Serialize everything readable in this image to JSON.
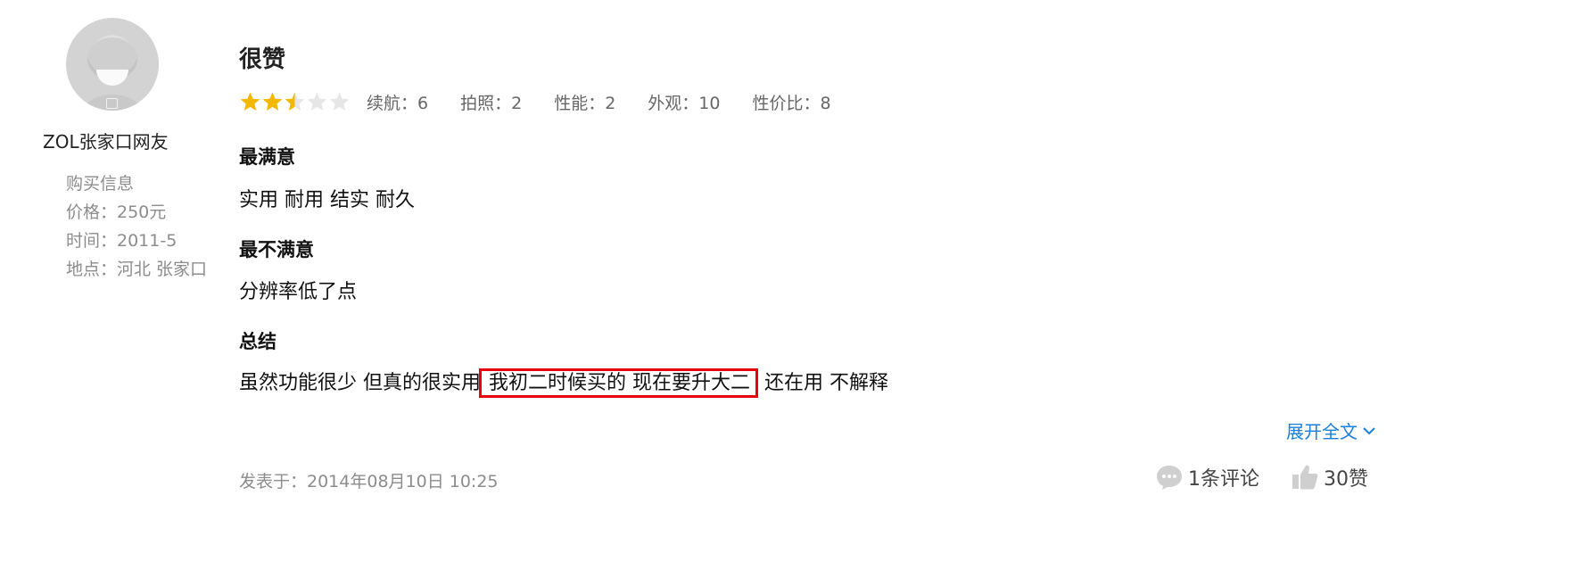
{
  "user": {
    "name": "ZOL张家口网友",
    "purchase_header": "购买信息",
    "price": "价格：250元",
    "time": "时间：2011-5",
    "location": "地点：河北 张家口"
  },
  "review": {
    "title": "很赞",
    "rating_stars": 2.5,
    "rating_max": 5,
    "scores": [
      {
        "label": "续航：6"
      },
      {
        "label": "拍照：2"
      },
      {
        "label": "性能：2"
      },
      {
        "label": "外观：10"
      },
      {
        "label": "性价比：8"
      }
    ],
    "best_heading": "最满意",
    "best_text": "实用 耐用 结实 耐久",
    "worst_heading": "最不满意",
    "worst_text": "分辨率低了点",
    "summary_heading": "总结",
    "summary_before": "虽然功能很少 但真的很实用",
    "summary_highlight": "我初二时候买的 现在要升大二",
    "summary_after": "还在用 不解释",
    "expand_label": "展开全文",
    "posted": "发表于：2014年08月10日 10:25"
  },
  "actions": {
    "comments_label": "1条评论",
    "likes_label": "30赞"
  },
  "colors": {
    "star_filled": "#f5b800",
    "star_empty": "#e6e6e6",
    "link": "#1a7fd8",
    "highlight_border": "#e8000d",
    "muted_text": "#8c8c8c"
  },
  "icons": [
    "user-avatar",
    "star-icon",
    "chevron-down-icon",
    "comment-bubble-icon",
    "thumbs-up-icon"
  ]
}
